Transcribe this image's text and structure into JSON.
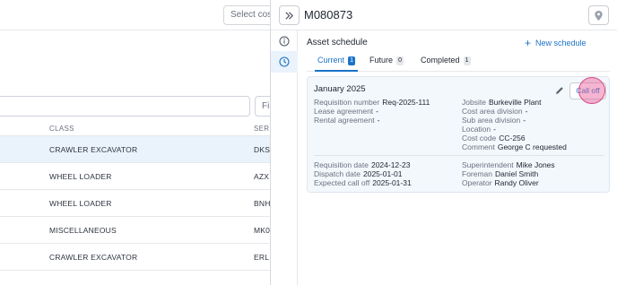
{
  "background": {
    "select_placeholder": "Select cos",
    "filter_placeholder": "Fi",
    "table": {
      "columns": [
        "CLASS",
        "SERI"
      ],
      "rows": [
        {
          "class": "CRAWLER EXCAVATOR",
          "serial": "DKS",
          "selected": true
        },
        {
          "class": "WHEEL LOADER",
          "serial": "AZX",
          "selected": false
        },
        {
          "class": "WHEEL LOADER",
          "serial": "BNH",
          "selected": false
        },
        {
          "class": "MISCELLANEOUS",
          "serial": "MK0",
          "selected": false
        },
        {
          "class": "CRAWLER EXCAVATOR",
          "serial": "ERL",
          "selected": false
        }
      ]
    }
  },
  "drawer": {
    "title": "M080873",
    "collapse_icon": "double-chevron-right-icon",
    "location_icon": "map-pin-icon",
    "rail": [
      {
        "icon": "info-icon",
        "active": false
      },
      {
        "icon": "clock-icon",
        "active": true
      }
    ],
    "section_title": "Asset schedule",
    "new_schedule_label": "New schedule",
    "tabs": [
      {
        "label": "Current",
        "count": "1",
        "active": true
      },
      {
        "label": "Future",
        "count": "0",
        "active": false
      },
      {
        "label": "Completed",
        "count": "1",
        "active": false
      }
    ],
    "card": {
      "title": "January 2025",
      "call_off_label": "Call off",
      "left_fields": [
        {
          "key": "Requisition number",
          "value": "Req-2025-111"
        },
        {
          "key": "Lease agreement",
          "value": "-"
        },
        {
          "key": "Rental agreement",
          "value": "-"
        }
      ],
      "right_fields": [
        {
          "key": "Jobsite",
          "value": "Burkeville Plant"
        },
        {
          "key": "Cost area division",
          "value": "-"
        },
        {
          "key": "Sub area division",
          "value": "-"
        },
        {
          "key": "Location",
          "value": "-"
        },
        {
          "key": "Cost code",
          "value": "CC-256"
        },
        {
          "key": "Comment",
          "value": "George C requested"
        }
      ],
      "bottom_left_fields": [
        {
          "key": "Requisition date",
          "value": "2024-12-23"
        },
        {
          "key": "Dispatch date",
          "value": "2025-01-01"
        },
        {
          "key": "Expected call off",
          "value": "2025-01-31"
        }
      ],
      "bottom_right_fields": [
        {
          "key": "Superintendent",
          "value": "Mike Jones"
        },
        {
          "key": "Foreman",
          "value": "Daniel Smith"
        },
        {
          "key": "Operator",
          "value": "Randy Oliver"
        }
      ]
    }
  },
  "colors": {
    "accent": "#1a73c8",
    "selected_row": "#eaf3fb",
    "card_bg": "#f3f8fc",
    "click_marker": "#d9488a"
  }
}
